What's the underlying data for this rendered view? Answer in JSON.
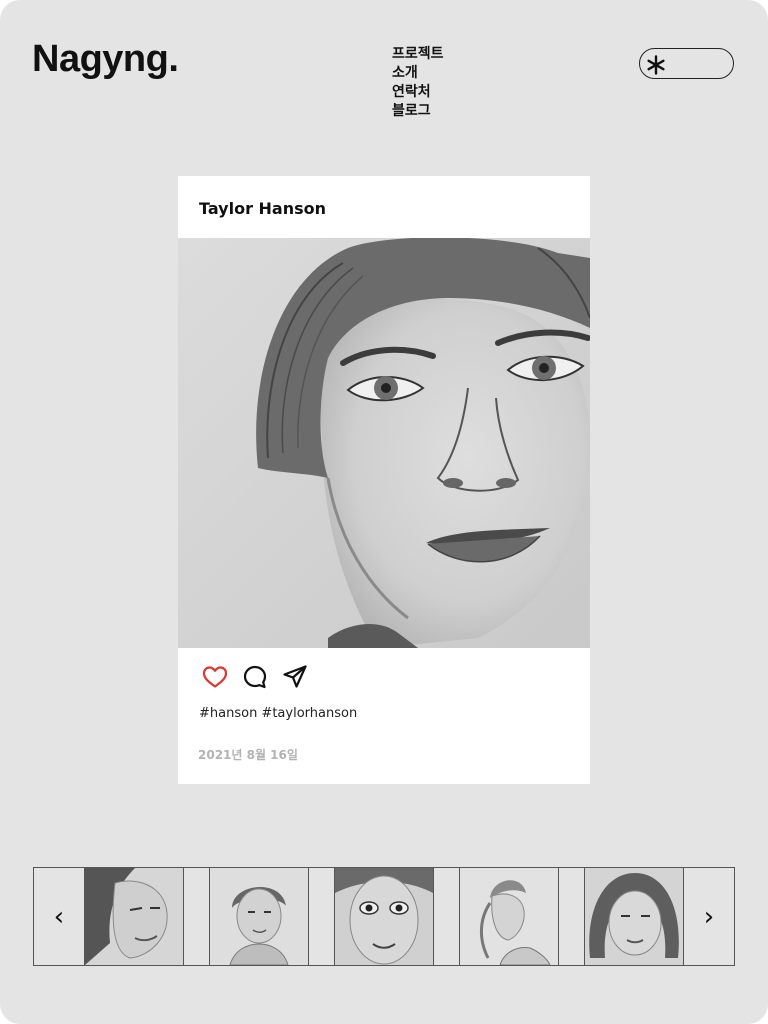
{
  "header": {
    "logo": "Nagyng.",
    "nav": [
      "프로젝트",
      "소개",
      "연락처",
      "블로그"
    ],
    "toggle_icon": "asterisk-icon"
  },
  "post": {
    "username": "Taylor Hanson",
    "image_icon": "pencil-portrait-image",
    "actions": [
      "heart-icon",
      "comment-icon",
      "share-icon"
    ],
    "like_color": "#e0352b",
    "hashtags": "#hanson #taylorhanson",
    "date": "2021년 8월 16일"
  },
  "gallery": {
    "prev_label": "‹",
    "next_label": "›",
    "thumbnails": [
      "portrait-curly-hair",
      "portrait-bowl-cut",
      "portrait-girl-front",
      "portrait-profile",
      "portrait-girl-bob"
    ]
  },
  "colors": {
    "background": "#e4e4e4",
    "card": "#ffffff",
    "text": "#111111",
    "date": "#b3b3b3"
  }
}
